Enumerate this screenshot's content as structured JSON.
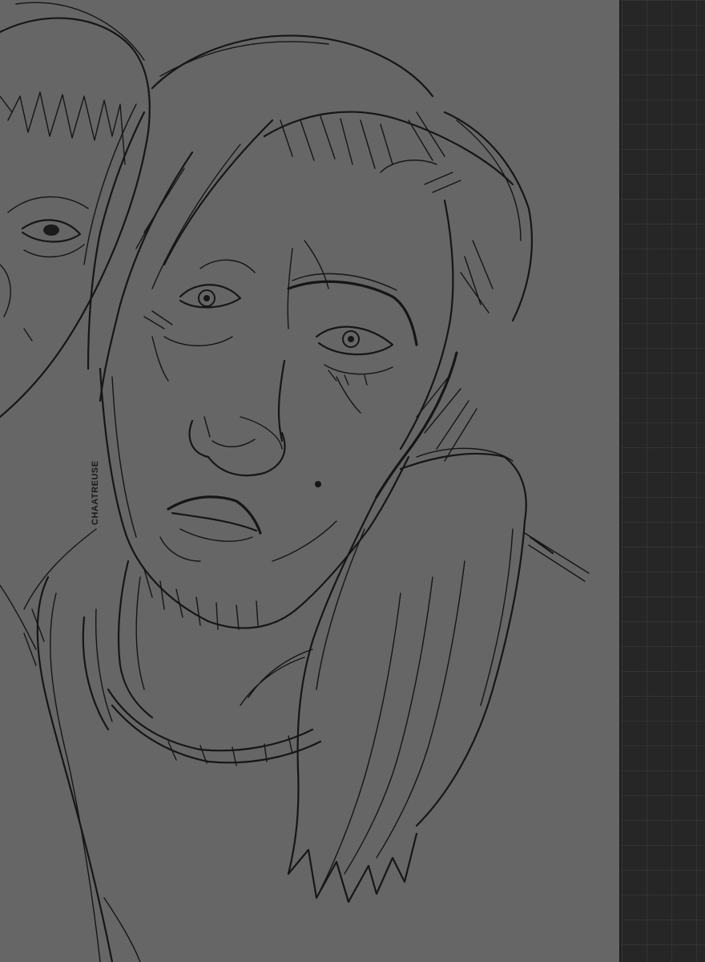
{
  "canvas": {
    "background": "#666666",
    "line_color": "#161616",
    "artwork_subject": "pencil-sketch-portrait",
    "signature_text": "CHAATREUSE"
  },
  "side_panel": {
    "type": "grid",
    "background": "#262626",
    "grid_color": "#333333"
  }
}
